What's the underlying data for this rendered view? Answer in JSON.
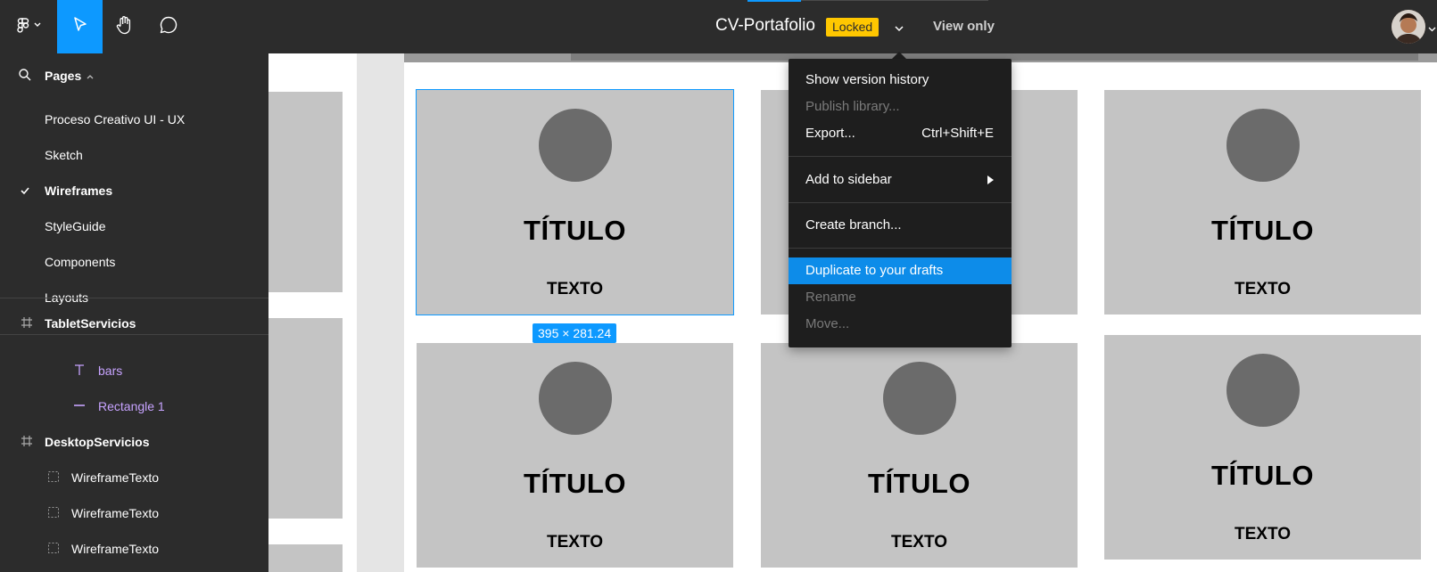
{
  "topbar": {
    "file_title": "CV-Portafolio",
    "locked_badge": "Locked",
    "view_mode": "View only",
    "icons": [
      "figma-logo-icon",
      "move-tool-icon",
      "hand-tool-icon",
      "comment-icon",
      "chevron-down-icon",
      "avatar"
    ]
  },
  "pages": {
    "header": "Pages",
    "items": [
      {
        "label": "Proceso Creativo UI - UX",
        "active": false
      },
      {
        "label": "Sketch",
        "active": false
      },
      {
        "label": "Wireframes",
        "active": true
      },
      {
        "label": "StyleGuide",
        "active": false
      },
      {
        "label": "Components",
        "active": false
      },
      {
        "label": "Layouts",
        "active": false
      }
    ]
  },
  "layers": {
    "items": [
      {
        "label": "TabletServicios",
        "type": "frame"
      },
      {
        "label": "bars",
        "type": "text"
      },
      {
        "label": "Rectangle 1",
        "type": "line"
      },
      {
        "label": "DesktopServicios",
        "type": "frame"
      },
      {
        "label": "WireframeTexto",
        "type": "group"
      },
      {
        "label": "WireframeTexto",
        "type": "group"
      },
      {
        "label": "WireframeTexto",
        "type": "group"
      }
    ]
  },
  "canvas": {
    "selection_dimensions": "395 × 281.24",
    "cards": [
      {
        "title": "TÍTULO",
        "text": "TEXTO"
      },
      {
        "title": "TÍTULO",
        "text": "TEXTO"
      },
      {
        "title": "TÍTULO",
        "text": "TEXTO"
      },
      {
        "title": "TÍTULO",
        "text": "TEXTO"
      },
      {
        "title": "TÍTULO",
        "text": "TEXTO"
      },
      {
        "title": "TÍTULO",
        "text": "TEXTO"
      }
    ]
  },
  "menu": {
    "show_version_history": "Show version history",
    "publish_library": "Publish library...",
    "export": "Export...",
    "export_shortcut": "Ctrl+Shift+E",
    "add_to_sidebar": "Add to sidebar",
    "create_branch": "Create branch...",
    "duplicate_to_drafts": "Duplicate to your drafts",
    "rename": "Rename",
    "move": "Move..."
  },
  "colors": {
    "accent": "#0d99ff",
    "locked": "#ffc700",
    "toolbar": "#2c2c2c",
    "menu": "#1e1e1e",
    "layer_purple": "#c7a3ff"
  }
}
